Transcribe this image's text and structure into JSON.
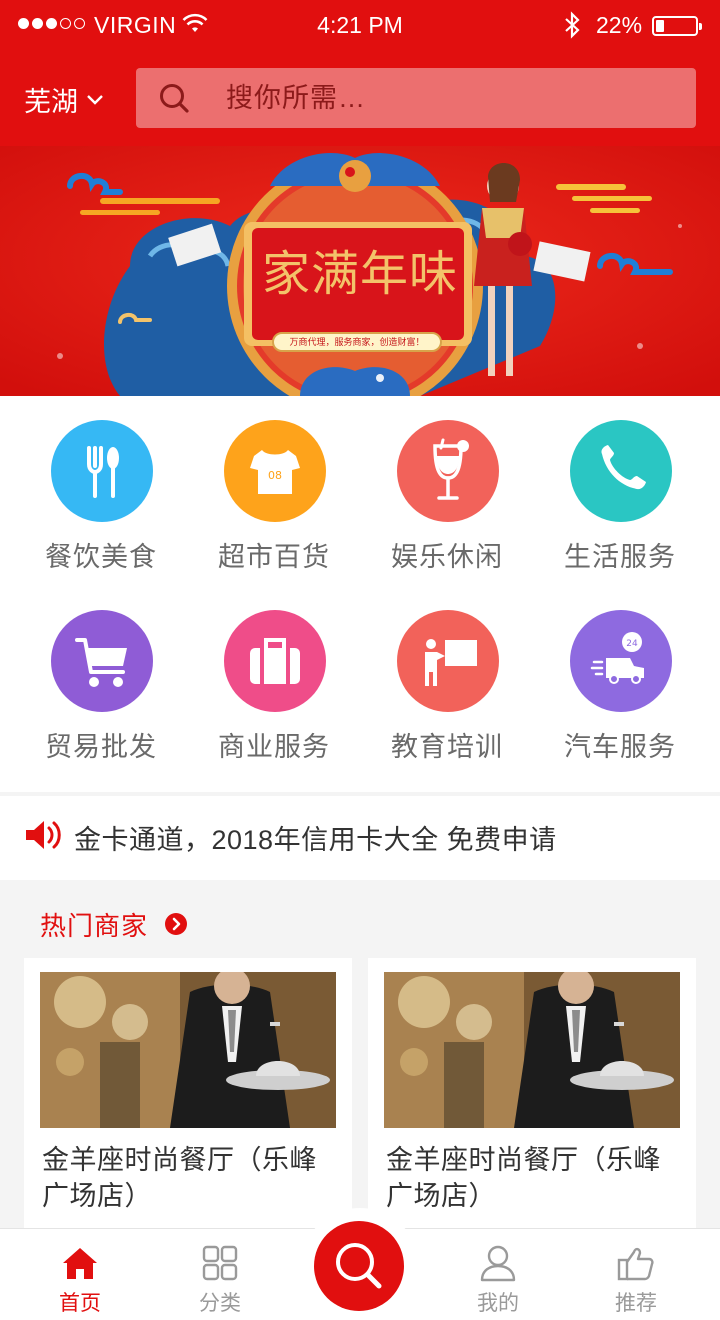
{
  "status_bar": {
    "carrier": "VIRGIN",
    "time": "4:21 PM",
    "battery_percent_text": "22%",
    "battery_level": 0.22,
    "signal_bars_filled": 3,
    "signal_bars_total": 5
  },
  "header": {
    "city": "芜湖",
    "search_placeholder": "搜你所需…"
  },
  "banner": {
    "title": "家满年味",
    "subtitle": "万商代理，服务商家，创造财富！"
  },
  "categories": [
    {
      "label": "餐饮美食",
      "icon": "cutlery-icon",
      "color": "#36b8f4"
    },
    {
      "label": "超市百货",
      "icon": "tshirt-icon",
      "color": "#fea31b"
    },
    {
      "label": "娱乐休闲",
      "icon": "cocktail-icon",
      "color": "#f2625a"
    },
    {
      "label": "生活服务",
      "icon": "phone-icon",
      "color": "#2ac6c3"
    },
    {
      "label": "贸易批发",
      "icon": "cart-icon",
      "color": "#8f5cd6"
    },
    {
      "label": "商业服务",
      "icon": "briefcase-icon",
      "color": "#ef4d89"
    },
    {
      "label": "教育培训",
      "icon": "teacher-board-icon",
      "color": "#f2625a"
    },
    {
      "label": "汽车服务",
      "icon": "delivery-van-icon",
      "color": "#8e6ae0"
    }
  ],
  "notice": {
    "text": "金卡通道，2018年信用卡大全  免费申请",
    "icon": "speaker-icon"
  },
  "hot_section": {
    "title": "热门商家",
    "merchants": [
      {
        "name": "金羊座时尚餐厅（乐峰广场店）"
      },
      {
        "name": "金羊座时尚餐厅（乐峰广场店）"
      }
    ]
  },
  "tabbar": {
    "tabs": [
      {
        "label": "首页",
        "icon": "home-icon",
        "active": true
      },
      {
        "label": "分类",
        "icon": "grid-icon",
        "active": false
      },
      {
        "label": "我的",
        "icon": "user-icon",
        "active": false
      },
      {
        "label": "推荐",
        "icon": "thumbs-up-icon",
        "active": false
      }
    ],
    "center_icon": "search-icon"
  },
  "colors": {
    "brand_red": "#e10f0f",
    "search_bg": "#ec6f6f",
    "inactive_tab": "#9a9a9a"
  }
}
